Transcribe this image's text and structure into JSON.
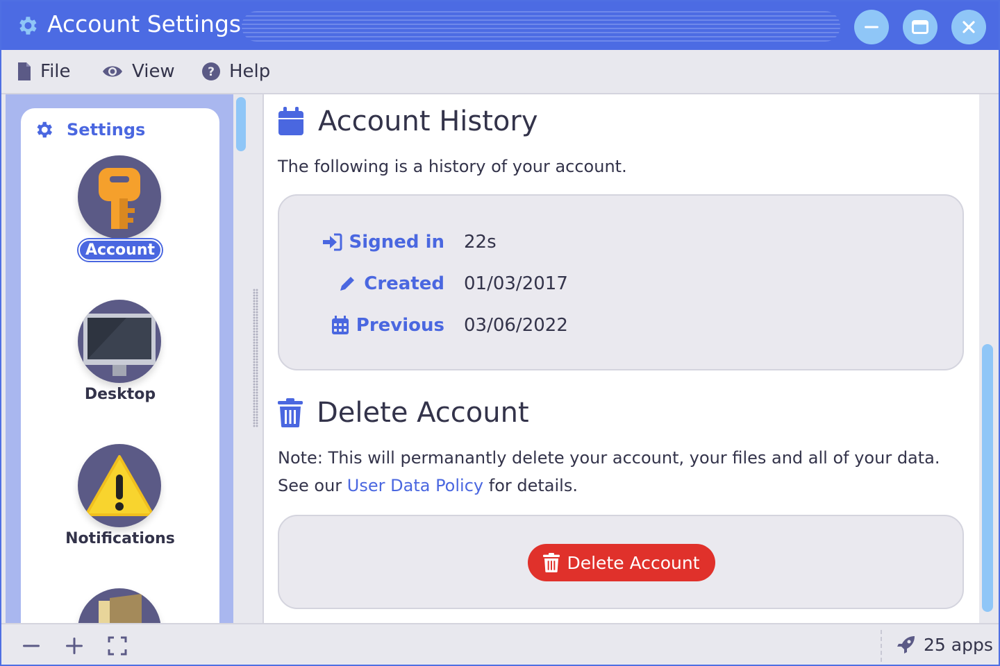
{
  "window": {
    "title": "Account Settings",
    "accent_color": "#4c6be3",
    "controls": [
      "minimize-icon",
      "maximize-icon",
      "close-icon"
    ]
  },
  "menu": {
    "items": [
      {
        "label": "File",
        "icon": "file-icon"
      },
      {
        "label": "View",
        "icon": "eye-icon"
      },
      {
        "label": "Help",
        "icon": "help-icon"
      }
    ]
  },
  "sidebar": {
    "header": "Settings",
    "items": [
      {
        "label": "Account",
        "icon": "key-icon",
        "active": true
      },
      {
        "label": "Desktop",
        "icon": "monitor-icon",
        "active": false
      },
      {
        "label": "Notifications",
        "icon": "warning-icon",
        "active": false
      },
      {
        "label": "",
        "icon": "door-icon",
        "active": false
      }
    ]
  },
  "history": {
    "title": "Account History",
    "description": "The following is a history of your account.",
    "rows": [
      {
        "label": "Signed in",
        "value": "22s",
        "icon": "sign-in-icon"
      },
      {
        "label": "Created",
        "value": "01/03/2017",
        "icon": "pencil-icon"
      },
      {
        "label": "Previous",
        "value": "03/06/2022",
        "icon": "calendar-icon"
      }
    ]
  },
  "delete": {
    "title": "Delete Account",
    "note": "Note: This will permanantly delete your account, your files and all of your data.",
    "see_prefix": "See our",
    "policy_link": "User Data Policy",
    "see_suffix": "for details.",
    "button_label": "Delete Account",
    "button_color": "#e0312b"
  },
  "statusbar": {
    "buttons": [
      "zoom-out-icon",
      "zoom-in-icon",
      "fullscreen-icon"
    ],
    "apps_count": "25 apps"
  }
}
